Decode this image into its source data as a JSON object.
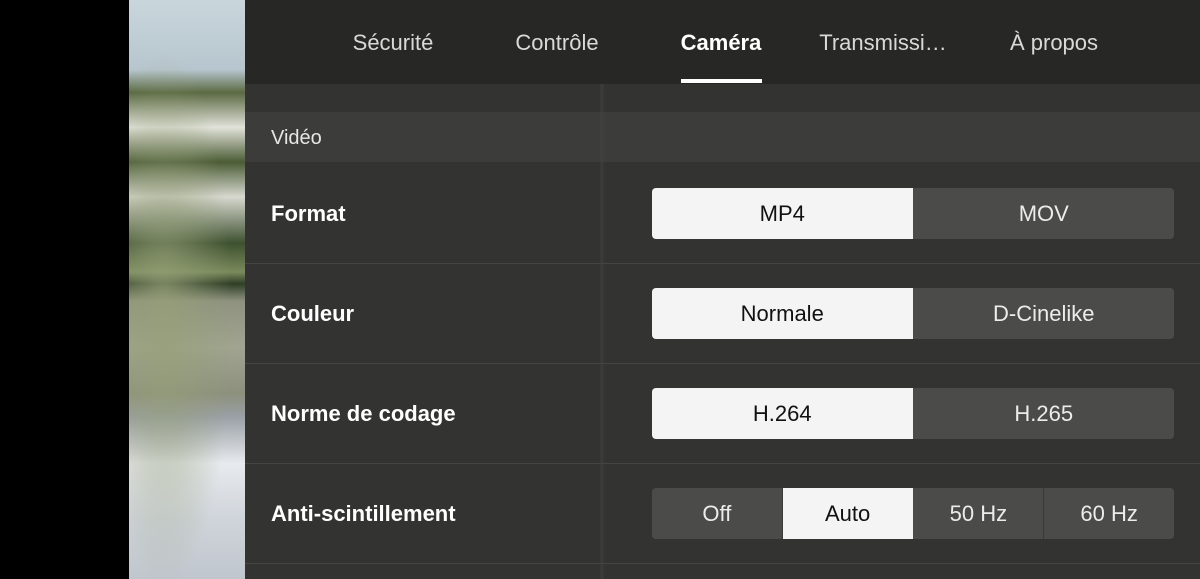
{
  "tabs": [
    {
      "label": "Sécurité",
      "active": false
    },
    {
      "label": "Contrôle",
      "active": false
    },
    {
      "label": "Caméra",
      "active": true
    },
    {
      "label": "Transmissi…",
      "active": false
    },
    {
      "label": "À propos",
      "active": false
    }
  ],
  "section": {
    "title": "Vidéo"
  },
  "settings": [
    {
      "label": "Format",
      "options": [
        "MP4",
        "MOV"
      ],
      "selected": "MP4"
    },
    {
      "label": "Couleur",
      "options": [
        "Normale",
        "D-Cinelike"
      ],
      "selected": "Normale"
    },
    {
      "label": "Norme de codage",
      "options": [
        "H.264",
        "H.265"
      ],
      "selected": "H.264"
    },
    {
      "label": "Anti-scintillement",
      "options": [
        "Off",
        "Auto",
        "50 Hz",
        "60 Hz"
      ],
      "selected": "Auto"
    }
  ]
}
